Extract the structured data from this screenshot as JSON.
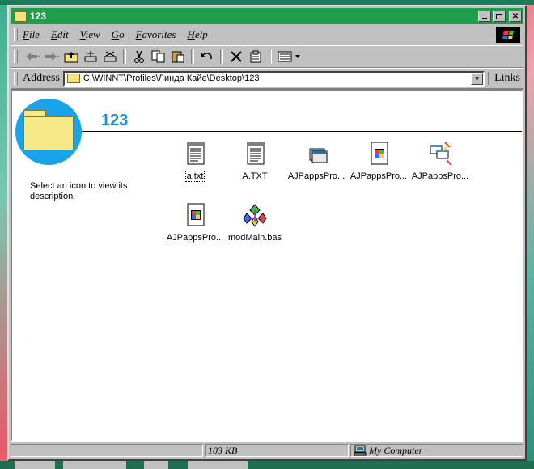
{
  "window": {
    "title": "123"
  },
  "menu": [
    "File",
    "Edit",
    "View",
    "Go",
    "Favorites",
    "Help"
  ],
  "toolbar": {
    "buttons": [
      "back-icon",
      "forward-icon",
      "up-folder-icon",
      "map-drive-icon",
      "disconnect-icon",
      "cut-icon",
      "copy-icon",
      "paste-icon",
      "undo-icon",
      "delete-icon",
      "properties-icon",
      "views-icon"
    ]
  },
  "address": {
    "label": "Address",
    "value": "C:\\WINNT\\Profiles\\Линда Кайе\\Desktop\\123",
    "links_label": "Links"
  },
  "folder": {
    "title": "123",
    "description": "Select an icon to view its description."
  },
  "files": [
    {
      "name": "a.txt",
      "icon": "text-file-icon",
      "focused": true
    },
    {
      "name": "A.TXT",
      "icon": "text-file-icon",
      "focused": false
    },
    {
      "name": "AJPappsPro...",
      "icon": "vb-group-icon",
      "focused": false
    },
    {
      "name": "AJPappsPro...",
      "icon": "vb-project-icon",
      "focused": false
    },
    {
      "name": "AJPappsPro...",
      "icon": "vb-workspace-icon",
      "focused": false
    },
    {
      "name": "AJPappsPro...",
      "icon": "vb-project-icon",
      "focused": false
    },
    {
      "name": "modMain.bas",
      "icon": "vb-module-icon",
      "focused": false
    }
  ],
  "status": {
    "size": "103 KB",
    "location": "My Computer"
  },
  "colors": {
    "titlebar": "#1e9e4a",
    "folder_title": "#1a8fdc",
    "circle": "#1aa3e8"
  }
}
